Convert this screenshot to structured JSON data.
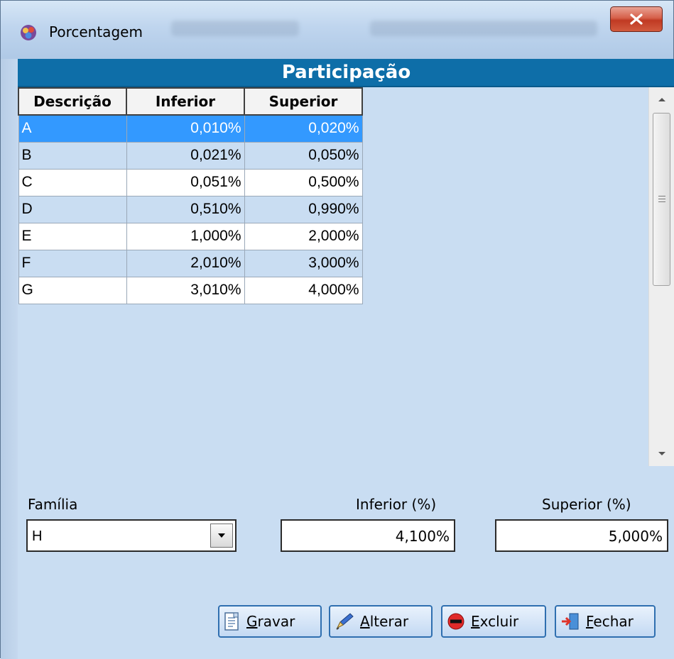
{
  "window": {
    "title": "Porcentagem"
  },
  "panel": {
    "header": "Participação"
  },
  "grid": {
    "columns": [
      "Descrição",
      "Inferior",
      "Superior"
    ],
    "rows": [
      {
        "descricao": "A",
        "inferior": "0,010%",
        "superior": "0,020%",
        "selected": true
      },
      {
        "descricao": "B",
        "inferior": "0,021%",
        "superior": "0,050%"
      },
      {
        "descricao": "C",
        "inferior": "0,051%",
        "superior": "0,500%"
      },
      {
        "descricao": "D",
        "inferior": "0,510%",
        "superior": "0,990%"
      },
      {
        "descricao": "E",
        "inferior": "1,000%",
        "superior": "2,000%"
      },
      {
        "descricao": "F",
        "inferior": "2,010%",
        "superior": "3,000%"
      },
      {
        "descricao": "G",
        "inferior": "3,010%",
        "superior": "4,000%"
      }
    ]
  },
  "form": {
    "familia_label": "Família",
    "familia_value": "H",
    "inferior_label": "Inferior (%)",
    "inferior_value": "4,100%",
    "superior_label": "Superior (%)",
    "superior_value": "5,000%"
  },
  "buttons": {
    "gravar": {
      "first": "G",
      "rest": "ravar",
      "icon": "save-icon"
    },
    "alterar": {
      "first": "A",
      "rest": "lterar",
      "icon": "pencil-icon"
    },
    "excluir": {
      "first": "E",
      "rest": "xcluir",
      "icon": "delete-icon"
    },
    "fechar": {
      "first": "F",
      "rest": "echar",
      "icon": "exit-icon"
    }
  },
  "colors": {
    "header_bg": "#0e6ea8",
    "client_bg": "#c9ddf2",
    "selected_row": "#3399ff"
  }
}
